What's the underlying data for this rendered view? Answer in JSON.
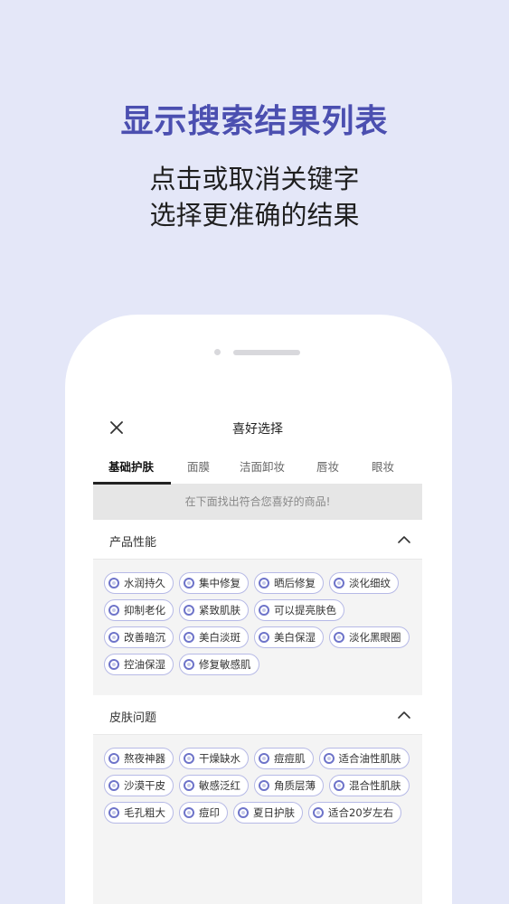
{
  "promo": {
    "title": "显示搜索结果列表",
    "line1": "点击或取消关键字",
    "line2": "选择更准确的结果"
  },
  "app": {
    "title": "喜好选择",
    "close_icon": "close-icon",
    "tabs": [
      {
        "label": "基础护肤",
        "active": true
      },
      {
        "label": "面膜",
        "active": false
      },
      {
        "label": "洁面卸妆",
        "active": false
      },
      {
        "label": "唇妆",
        "active": false
      },
      {
        "label": "眼妆",
        "active": false
      }
    ],
    "notice": "在下面找出符合您喜好的商品!",
    "sections": [
      {
        "title": "产品性能",
        "expand_icon": "chevron-up-icon",
        "tags": [
          "水润持久",
          "集中修复",
          "晒后修复",
          "淡化细纹",
          "抑制老化",
          "紧致肌肤",
          "可以提亮肤色",
          "改善暗沉",
          "美白淡斑",
          "美白保湿",
          "淡化黑眼圈",
          "控油保湿",
          "修复敏感肌"
        ]
      },
      {
        "title": "皮肤问题",
        "expand_icon": "chevron-up-icon",
        "tags": [
          "熬夜神器",
          "干燥缺水",
          "痘痘肌",
          "适合油性肌肤",
          "沙漠干皮",
          "敏感泛红",
          "角质层薄",
          "混合性肌肤",
          "毛孔粗大",
          "痘印",
          "夏日护肤",
          "适合20岁左右"
        ]
      }
    ]
  },
  "colors": {
    "background": "#e4e7f8",
    "accent": "#4b4fb0",
    "tag_border": "#b6b9e6"
  }
}
